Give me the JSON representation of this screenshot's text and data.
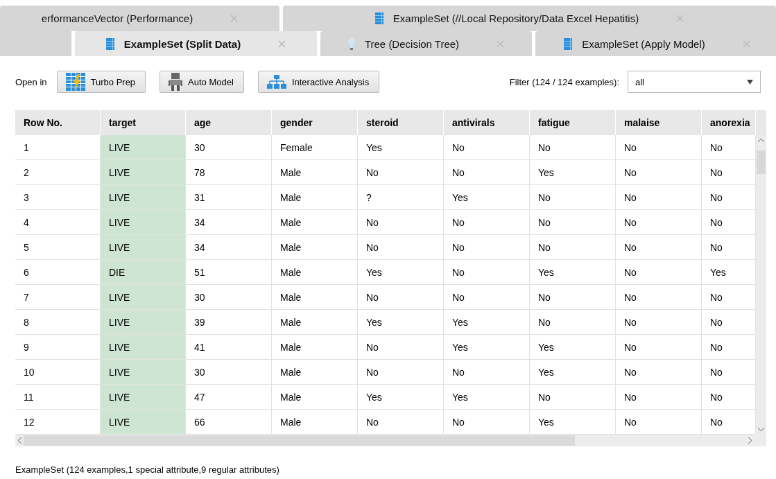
{
  "tab_rows": [
    {
      "tabs": [
        {
          "label": "erformanceVector (Performance)",
          "selected": false
        },
        {
          "label": "ExampleSet (//Local Repository/Data Excel Hepatitis)",
          "selected": false
        }
      ]
    },
    {
      "tabs": [
        {
          "label": "ExampleSet (Split Data)",
          "selected": true
        },
        {
          "label": "Tree (Decision Tree)",
          "selected": false
        },
        {
          "label": "ExampleSet (Apply Model)",
          "selected": false
        }
      ]
    }
  ],
  "toolbar": {
    "open_in_label": "Open in",
    "buttons": [
      {
        "label": "Turbo Prep"
      },
      {
        "label": "Auto Model"
      },
      {
        "label": "Interactive Analysis"
      }
    ],
    "filter_label": "Filter (124 / 124 examples):",
    "filter_value": "all"
  },
  "table": {
    "columns": [
      "Row No.",
      "target",
      "age",
      "gender",
      "steroid",
      "antivirals",
      "fatigue",
      "malaise",
      "anorexia"
    ],
    "rows": [
      [
        "1",
        "LIVE",
        "30",
        "Female",
        "Yes",
        "No",
        "No",
        "No",
        "No"
      ],
      [
        "2",
        "LIVE",
        "78",
        "Male",
        "No",
        "No",
        "Yes",
        "No",
        "No"
      ],
      [
        "3",
        "LIVE",
        "31",
        "Male",
        "?",
        "Yes",
        "No",
        "No",
        "No"
      ],
      [
        "4",
        "LIVE",
        "34",
        "Male",
        "No",
        "No",
        "No",
        "No",
        "No"
      ],
      [
        "5",
        "LIVE",
        "34",
        "Male",
        "No",
        "No",
        "No",
        "No",
        "No"
      ],
      [
        "6",
        "DIE",
        "51",
        "Male",
        "Yes",
        "No",
        "Yes",
        "No",
        "Yes"
      ],
      [
        "7",
        "LIVE",
        "30",
        "Male",
        "No",
        "No",
        "No",
        "No",
        "No"
      ],
      [
        "8",
        "LIVE",
        "39",
        "Male",
        "Yes",
        "Yes",
        "No",
        "No",
        "No"
      ],
      [
        "9",
        "LIVE",
        "41",
        "Male",
        "No",
        "Yes",
        "Yes",
        "No",
        "No"
      ],
      [
        "10",
        "LIVE",
        "30",
        "Male",
        "No",
        "No",
        "Yes",
        "No",
        "No"
      ],
      [
        "11",
        "LIVE",
        "47",
        "Male",
        "Yes",
        "Yes",
        "No",
        "No",
        "No"
      ],
      [
        "12",
        "LIVE",
        "66",
        "Male",
        "No",
        "No",
        "Yes",
        "No",
        "No"
      ]
    ]
  },
  "status_bar": "ExampleSet (124 examples,1 special attribute,9 regular attributes)"
}
